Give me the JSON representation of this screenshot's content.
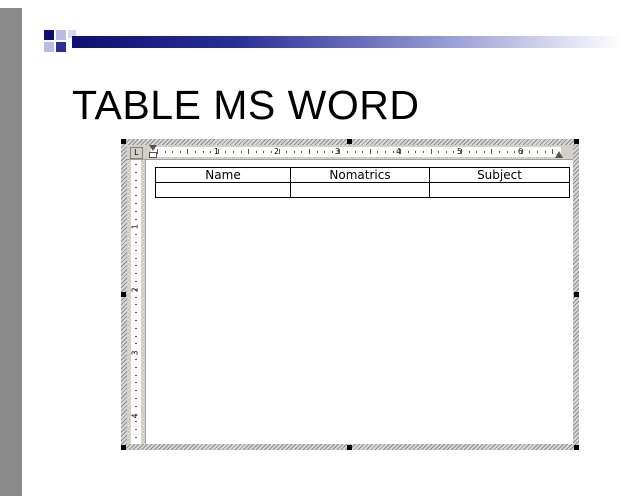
{
  "slide": {
    "title": "TABLE MS WORD"
  },
  "word": {
    "ruler_h_numbers": [
      "1",
      "2",
      "3",
      "4",
      "5",
      "6"
    ],
    "ruler_v_numbers": [
      "1",
      "2",
      "3",
      "4"
    ],
    "table": {
      "headers": [
        "Name",
        "Nomatrics",
        "Subject"
      ],
      "rows": [
        [
          "",
          "",
          ""
        ]
      ]
    }
  },
  "colors": {
    "accent": "#0d1070",
    "sidebar": "#8a8a8a"
  }
}
